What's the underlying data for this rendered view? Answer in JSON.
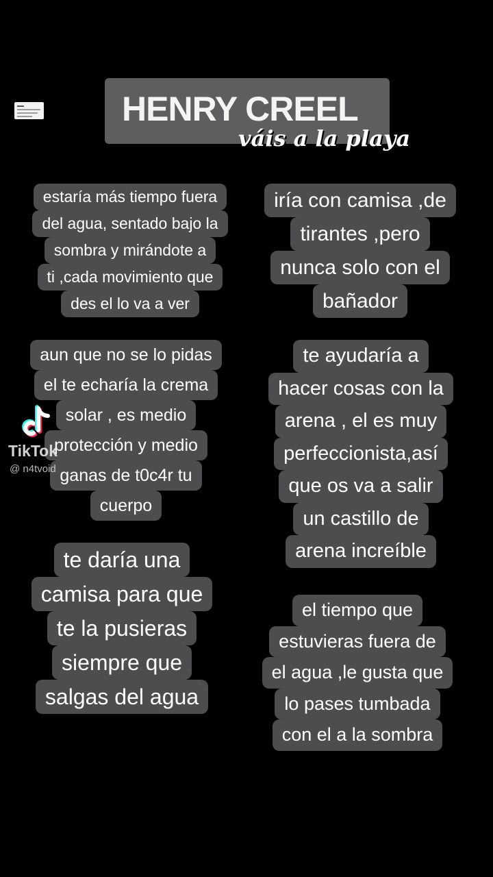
{
  "header": {
    "title": "HENRY CREEL",
    "subtitle": "váis a la playa"
  },
  "watermark": {
    "logo_icon": "tiktok-note-icon",
    "brand": "TikTok",
    "username": "@ n4tvoid"
  },
  "cards": [
    {
      "lines": [
        "estaría más tiempo fuera",
        "del agua, sentado bajo la",
        "sombra y mirándote a",
        "ti ,cada movimiento que",
        "des el lo va a ver"
      ]
    },
    {
      "lines": [
        "iría con camisa ,de",
        "tirantes ,pero",
        "nunca solo con el",
        "bañador"
      ]
    },
    {
      "lines": [
        "aun que no se lo pidas",
        "el te echaría la crema",
        "solar , es medio",
        "protección y medio",
        "ganas de t0c4r tu",
        "cuerpo"
      ]
    },
    {
      "lines": [
        "te ayudaría a",
        "hacer cosas con la",
        "arena ,  el es muy",
        "perfeccionista,así",
        "que os va a salir",
        "un castillo de",
        "arena increíble"
      ]
    },
    {
      "lines": [
        "te daría una",
        "camisa para que",
        "te la pusieras",
        "siempre que",
        "salgas del agua"
      ]
    },
    {
      "lines": [
        "el tiempo que",
        "estuvieras fuera de",
        "el agua ,le gusta que",
        "lo pases tumbada",
        "con el a la sombra"
      ]
    }
  ]
}
